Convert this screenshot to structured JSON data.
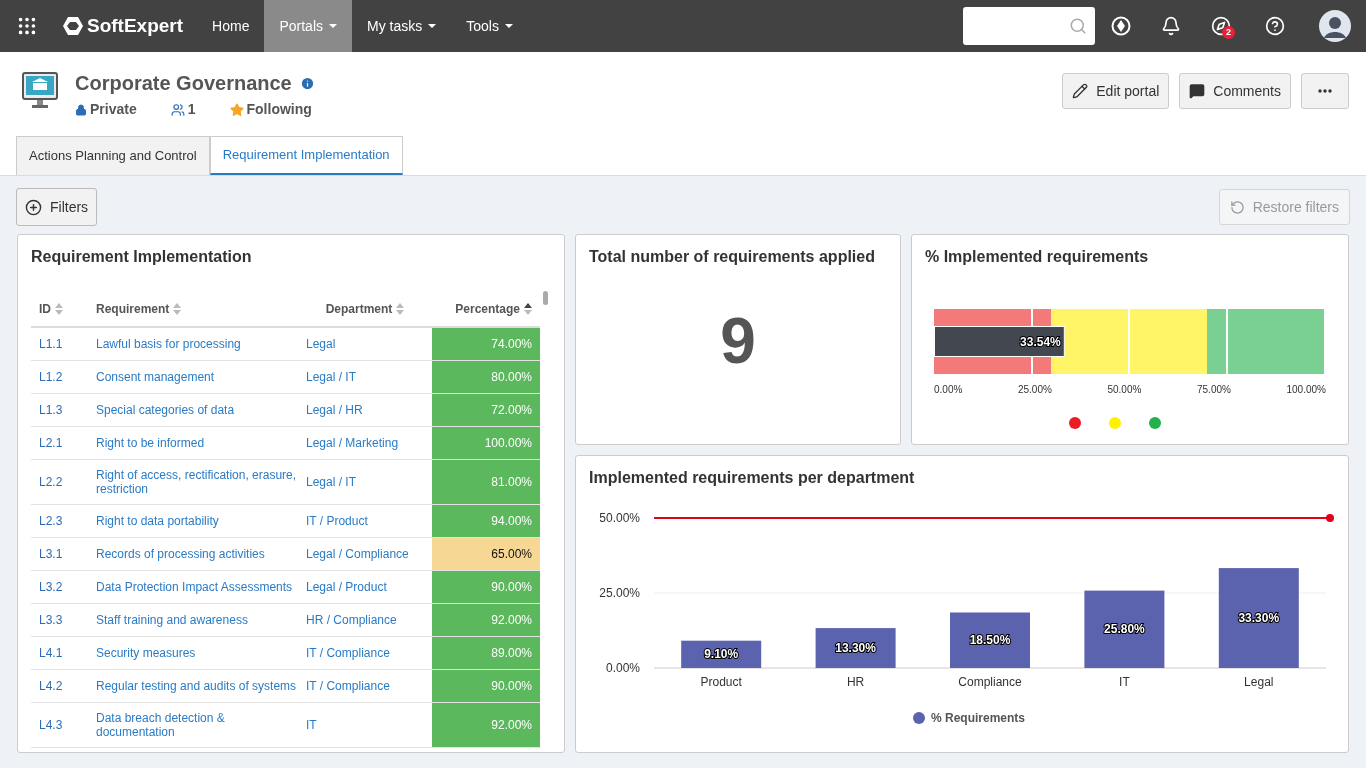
{
  "topbar": {
    "brand": "SoftExpert",
    "nav": [
      {
        "label": "Home",
        "selected": false,
        "dropdown": false
      },
      {
        "label": "Portals",
        "selected": true,
        "dropdown": true
      },
      {
        "label": "My tasks",
        "selected": false,
        "dropdown": true
      },
      {
        "label": "Tools",
        "selected": false,
        "dropdown": true
      }
    ],
    "notification_count": "2"
  },
  "portal": {
    "title": "Corporate Governance",
    "privacy": "Private",
    "members": "1",
    "following": "Following",
    "actions": [
      "Edit portal",
      "Comments"
    ]
  },
  "tabs": [
    {
      "label": "Actions Planning and Control",
      "selected": false
    },
    {
      "label": "Requirement Implementation",
      "selected": true
    }
  ],
  "toolbar": {
    "filters": "Filters",
    "restore": "Restore filters",
    "restore_disabled": true
  },
  "table_card": {
    "title": "Requirement Implementation",
    "columns": [
      {
        "label": "ID",
        "sorted": false
      },
      {
        "label": "Requirement",
        "sorted": false
      },
      {
        "label": "Department",
        "sorted": false
      },
      {
        "label": "Percentage",
        "sorted": true
      }
    ],
    "rows": [
      {
        "id": "L1.1",
        "requirement": "Lawful basis for processing",
        "department": "Legal",
        "percentage": "74.00%",
        "color": "#5cb85c"
      },
      {
        "id": "L1.2",
        "requirement": "Consent management",
        "department": "Legal / IT",
        "percentage": "80.00%",
        "color": "#5cb85c"
      },
      {
        "id": "L1.3",
        "requirement": "Special categories of data",
        "department": "Legal / HR",
        "percentage": "72.00%",
        "color": "#5cb85c"
      },
      {
        "id": "L2.1",
        "requirement": "Right to be informed",
        "department": "Legal / Marketing",
        "percentage": "100.00%",
        "color": "#5cb85c"
      },
      {
        "id": "L2.2",
        "requirement": "Right of access, rectification, erasure, restriction",
        "department": "Legal / IT",
        "percentage": "81.00%",
        "color": "#5cb85c"
      },
      {
        "id": "L2.3",
        "requirement": "Right to data portability",
        "department": "IT / Product",
        "percentage": "94.00%",
        "color": "#5cb85c"
      },
      {
        "id": "L3.1",
        "requirement": "Records of processing activities",
        "department": "Legal / Compliance",
        "percentage": "65.00%",
        "color": "#f7d794"
      },
      {
        "id": "L3.2",
        "requirement": "Data Protection Impact Assessments",
        "department": "Legal / Product",
        "percentage": "90.00%",
        "color": "#5cb85c"
      },
      {
        "id": "L3.3",
        "requirement": "Staff training and awareness",
        "department": "HR / Compliance",
        "percentage": "92.00%",
        "color": "#5cb85c"
      },
      {
        "id": "L4.1",
        "requirement": "Security measures",
        "department": "IT / Compliance",
        "percentage": "89.00%",
        "color": "#5cb85c"
      },
      {
        "id": "L4.2",
        "requirement": "Regular testing and audits of systems",
        "department": "IT / Compliance",
        "percentage": "90.00%",
        "color": "#5cb85c"
      },
      {
        "id": "L4.3",
        "requirement": "Data breach detection & documentation",
        "department": "IT",
        "percentage": "92.00%",
        "color": "#5cb85c"
      }
    ]
  },
  "total_card": {
    "title": "Total number of requirements applied",
    "value": "9"
  },
  "gauge_card": {
    "title": "% Implemented requirements",
    "level": 0.3354,
    "reading": "33.54%",
    "ticks": [
      "0.00%",
      "25.00%",
      "50.00%",
      "75.00%",
      "100.00%"
    ],
    "legend": [
      {
        "color": "#ed1c24"
      },
      {
        "color": "#fff200"
      },
      {
        "color": "#22b14c"
      }
    ]
  },
  "bar_card": {
    "title": "Implemented requirements per department",
    "chart_data": {
      "type": "bar",
      "categories": [
        "Product",
        "HR",
        "Compliance",
        "IT",
        "Legal"
      ],
      "series": [
        {
          "name": "% Requirements",
          "color": "#5b62ae",
          "values": [
            9.1,
            13.3,
            18.5,
            25.8,
            33.3
          ]
        }
      ],
      "ylim": [
        0,
        50
      ],
      "yticks": [
        {
          "value": 0,
          "label": "0.00%"
        },
        {
          "value": 25,
          "label": "25.00%"
        },
        {
          "value": 50,
          "label": "50.00%"
        }
      ],
      "value_labels": [
        "9.10%",
        "13.30%",
        "18.50%",
        "25.80%",
        "33.30%"
      ]
    }
  }
}
